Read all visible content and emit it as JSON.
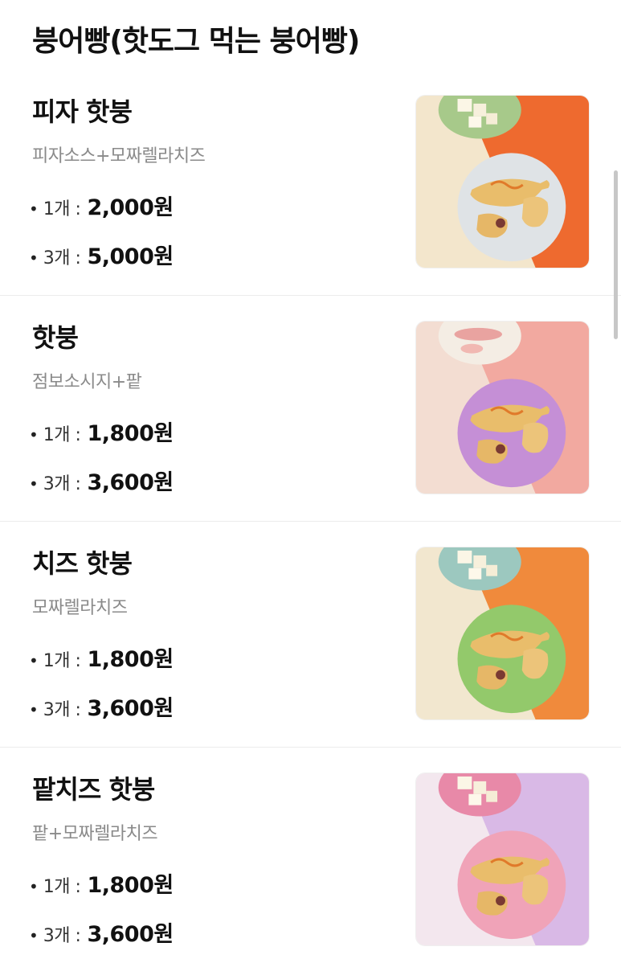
{
  "section": {
    "title": "붕어빵(핫도그 먹는 붕어빵)"
  },
  "items": [
    {
      "name": "피자 핫붕",
      "desc": "피자소스+모짜렐라치즈",
      "prices": [
        {
          "qty": "1개 :",
          "price": "2,000원"
        },
        {
          "qty": "3개 :",
          "price": "5,000원"
        }
      ],
      "image": {
        "bg_main": "#ee6a2f",
        "bg_alt": "#f3e6cc",
        "plate": "#dfe3e6",
        "side_plate": "#a7c98a",
        "side_item": "cheese-cubes-icon"
      }
    },
    {
      "name": "핫붕",
      "desc": "점보소시지+팥",
      "prices": [
        {
          "qty": "1개 :",
          "price": "1,800원"
        },
        {
          "qty": "3개 :",
          "price": "3,600원"
        }
      ],
      "image": {
        "bg_main": "#f2a9a0",
        "bg_alt": "#f3ddd2",
        "plate": "#c58fd6",
        "side_plate": "#f4ede4",
        "side_item": "sausage-icon"
      }
    },
    {
      "name": "치즈 핫붕",
      "desc": "모짜렐라치즈",
      "prices": [
        {
          "qty": "1개 :",
          "price": "1,800원"
        },
        {
          "qty": "3개 :",
          "price": "3,600원"
        }
      ],
      "image": {
        "bg_main": "#f08a3c",
        "bg_alt": "#f2e7cf",
        "plate": "#93c96b",
        "side_plate": "#9cc8bf",
        "side_item": "cheese-cubes-icon"
      }
    },
    {
      "name": "팥치즈 핫붕",
      "desc": "팥+모짜렐라치즈",
      "prices": [
        {
          "qty": "1개 :",
          "price": "1,800원"
        },
        {
          "qty": "3개 :",
          "price": "3,600원"
        }
      ],
      "image": {
        "bg_main": "#d9b9e6",
        "bg_alt": "#f3e7ee",
        "plate": "#f0a3b8",
        "side_plate": "#e889a8",
        "side_item": "cheese-cubes-icon"
      }
    }
  ]
}
